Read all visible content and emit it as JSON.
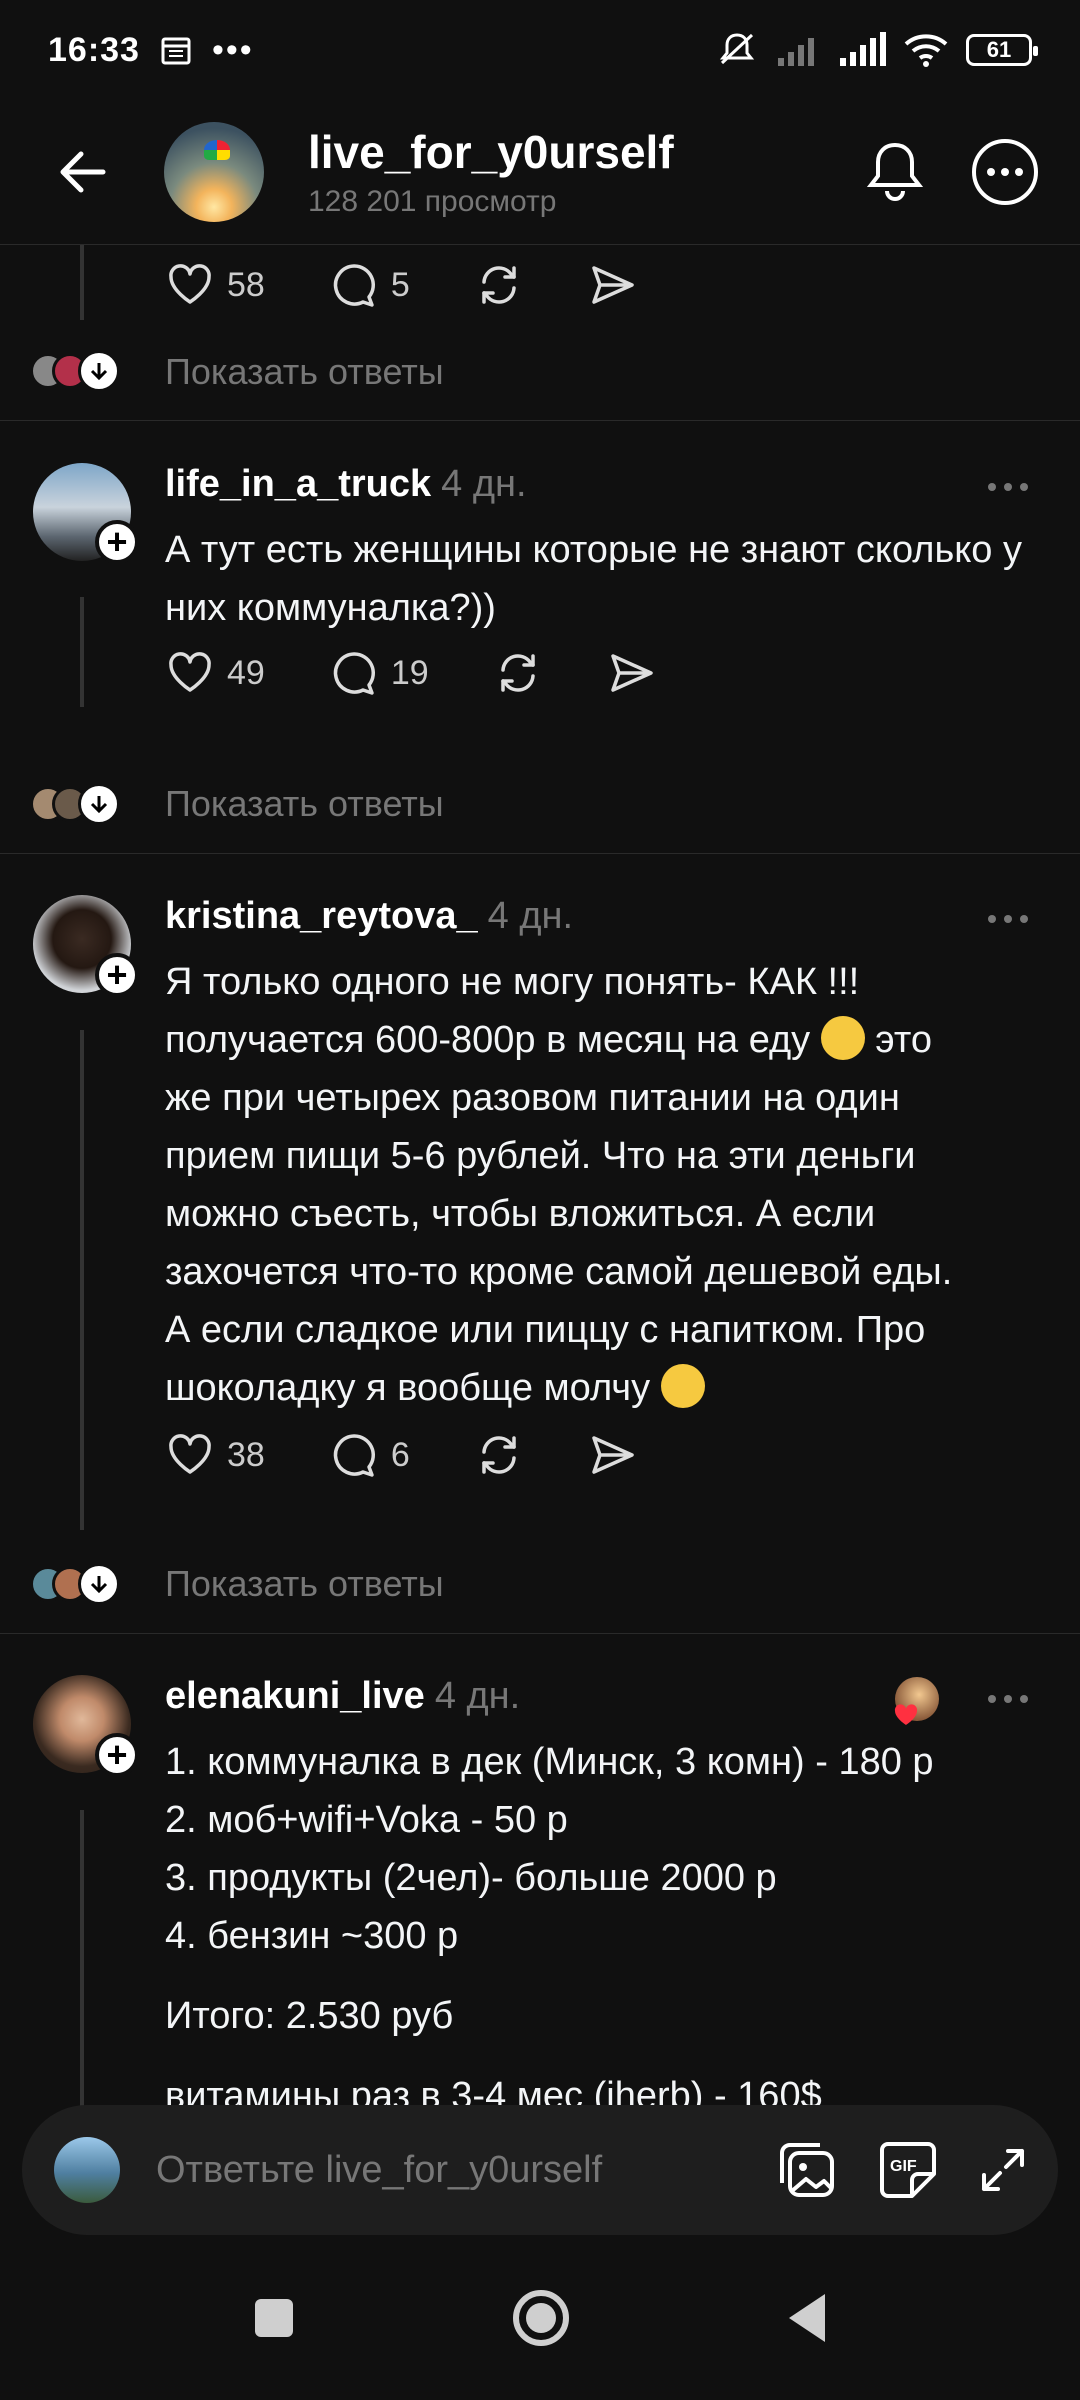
{
  "status": {
    "time": "16:33",
    "battery": "61"
  },
  "header": {
    "title": "live_for_y0urself",
    "views": "128 201 просмотр"
  },
  "top_post": {
    "likes": "58",
    "replies": "5",
    "show_replies": "Показать ответы"
  },
  "comments": [
    {
      "user": "life_in_a_truck",
      "ago": "4 дн.",
      "text": "А тут есть женщины которые не знают сколько у них коммуналка?))",
      "likes": "49",
      "replies": "19",
      "show_replies": "Показать ответы"
    },
    {
      "user": "kristina_reytova_",
      "ago": "4 дн.",
      "text_lines": [
        "Я только одного не могу понять- КАК !!!",
        "получается 600-800р в месяц на еду",
        "это",
        "же при четырех разовом питании на один",
        "прием пищи 5-6 рублей. Что на эти деньги",
        "можно съесть, чтобы вложиться. А если",
        "захочется что-то кроме самой дешевой еды.",
        "А если сладкое или пиццу с напитком. Про",
        "шоколадку я вообще молчу"
      ],
      "likes": "38",
      "replies": "6",
      "show_replies": "Показать ответы"
    },
    {
      "user": "elenakuni_live",
      "ago": "4 дн.",
      "lines": [
        "1. коммуналка в дек (Минск, 3 комн) - 180 р",
        "2. моб+wifi+Voka - 50 р",
        "3. продукты (2чел)- больше 2000 р",
        "4. бензин ~300 р"
      ],
      "total": "Итого: 2.530 руб",
      "cut_line": "витамины раз в 3-4 мес (iherb) - 160$"
    }
  ],
  "composer": {
    "placeholder": "Ответьте live_for_y0urself"
  },
  "colors": {
    "background": "#101010",
    "text": "#f3f5f7",
    "muted": "#777777"
  }
}
